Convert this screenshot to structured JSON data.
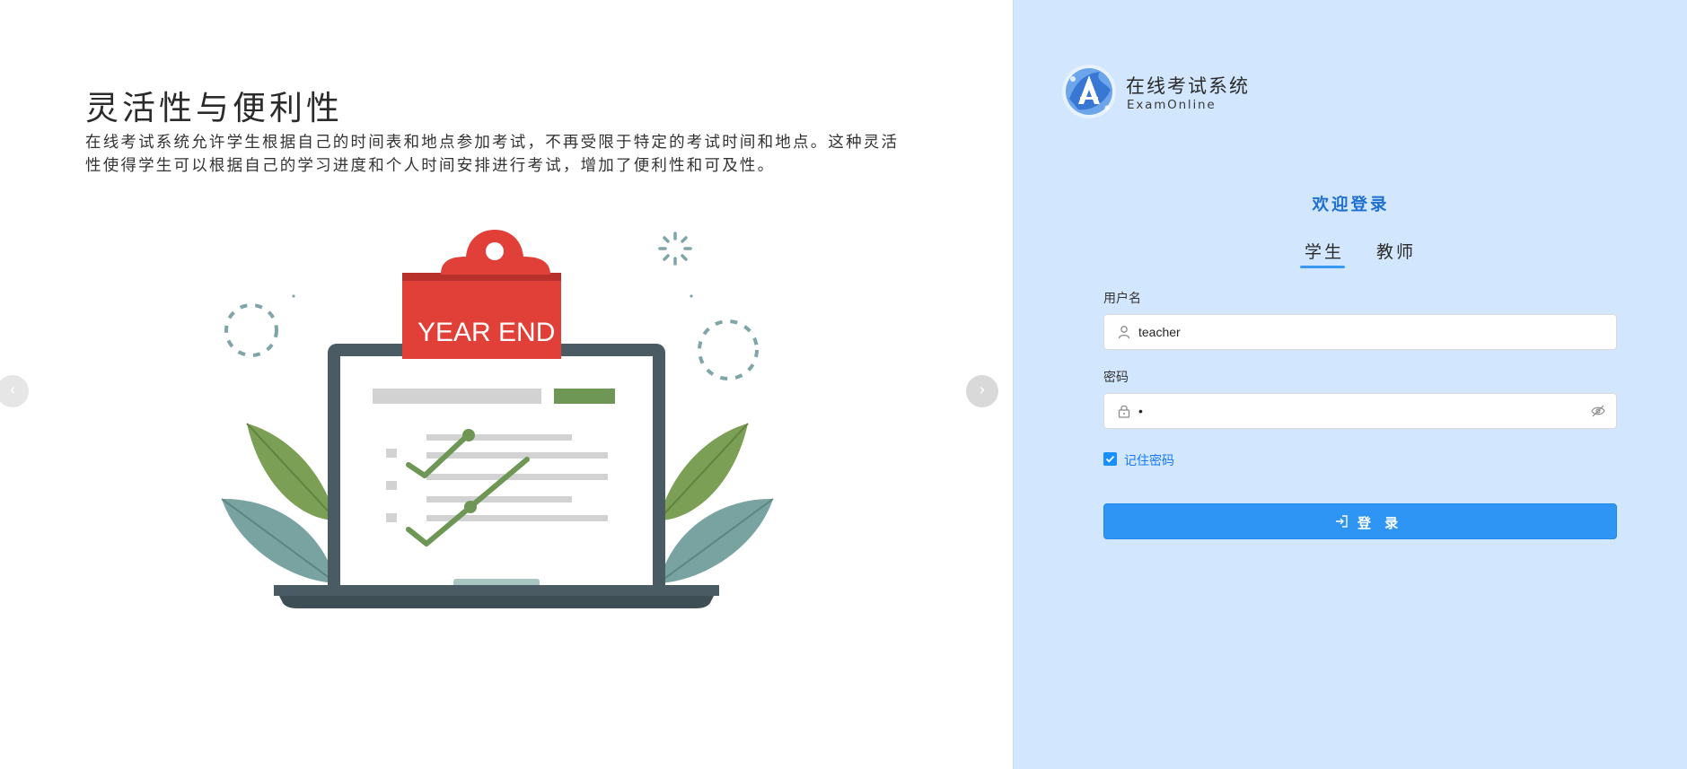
{
  "slide": {
    "title": "灵活性与便利性",
    "description": "在线考试系统允许学生根据自己的时间表和地点参加考试，不再受限于特定的考试时间和地点。这种灵活性使得学生可以根据自己的学习进度和个人时间安排进行考试，增加了便利性和可及性。",
    "illustration_text": "YEAR END",
    "prev_arrow": "‹",
    "next_arrow": "›"
  },
  "brand": {
    "name": "在线考试系统",
    "subtitle": "ExamOnline"
  },
  "login": {
    "welcome": "欢迎登录",
    "tabs": [
      {
        "label": "学生",
        "active": true
      },
      {
        "label": "教师",
        "active": false
      }
    ],
    "username_label": "用户名",
    "username_value": "teacher",
    "password_label": "密码",
    "password_value": "•",
    "remember_label": "记住密码",
    "remember_checked": true,
    "submit_label": "登 录"
  },
  "colors": {
    "panel_bg": "#d2e7fd",
    "accent": "#2f95f5",
    "welcome_text": "#1f6fd0"
  },
  "icons": {
    "username": "user-icon",
    "password": "lock-icon",
    "password_toggle": "eye-off-icon",
    "submit": "login-arrow-icon"
  }
}
